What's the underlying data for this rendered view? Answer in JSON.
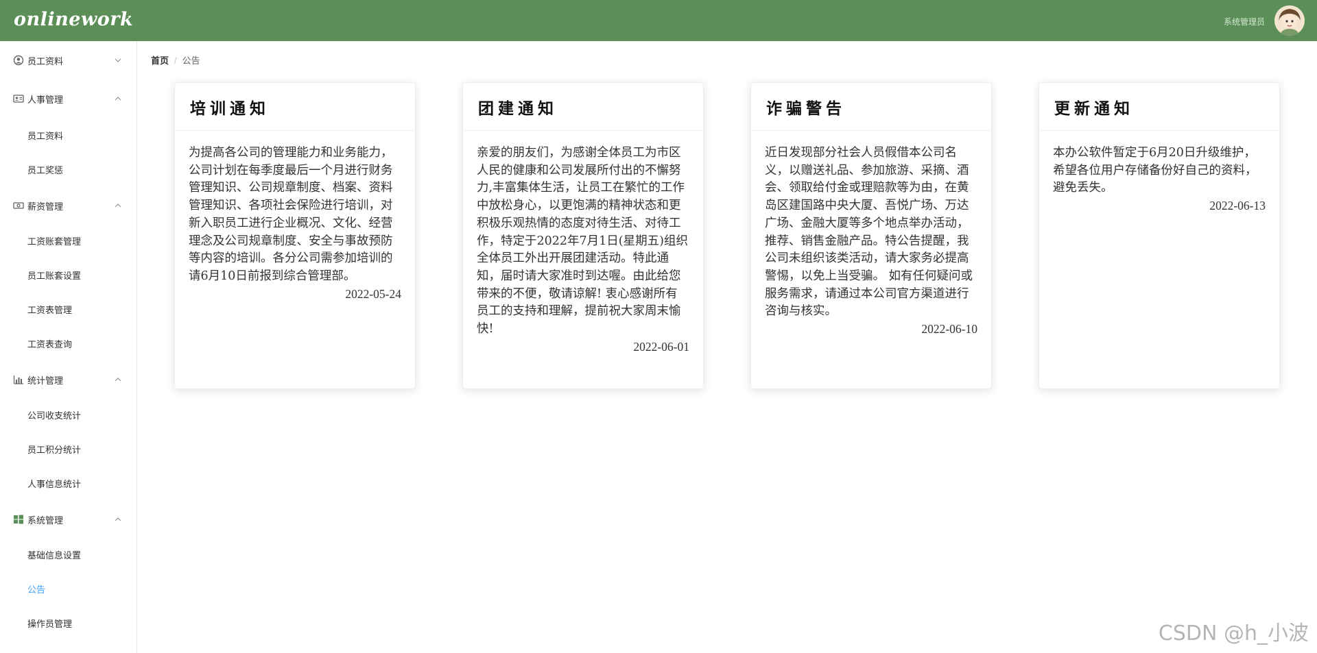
{
  "header": {
    "logo": "onlinework",
    "user": "系统管理员",
    "accent_color": "#5b8f57"
  },
  "sidebar": {
    "groups": [
      {
        "label": "员工资料",
        "icon": "user-circle-icon",
        "expanded": false,
        "items": []
      },
      {
        "label": "人事管理",
        "icon": "id-card-icon",
        "expanded": true,
        "items": [
          "员工资料",
          "员工奖惩"
        ]
      },
      {
        "label": "薪资管理",
        "icon": "money-icon",
        "expanded": true,
        "items": [
          "工资账套管理",
          "员工账套设置",
          "工资表管理",
          "工资表查询"
        ]
      },
      {
        "label": "统计管理",
        "icon": "bar-chart-icon",
        "expanded": true,
        "items": [
          "公司收支统计",
          "员工积分统计",
          "人事信息统计"
        ]
      },
      {
        "label": "系统管理",
        "icon": "windows-icon",
        "expanded": true,
        "items": [
          "基础信息设置",
          "公告",
          "操作员管理"
        ]
      }
    ],
    "active_item": "公告",
    "active_color": "#409eff"
  },
  "breadcrumb": {
    "home": "首页",
    "separator": "/",
    "current": "公告"
  },
  "notices": [
    {
      "title": "培训通知",
      "content": "为提高各公司的管理能力和业务能力，公司计划在每季度最后一个月进行财务管理知识、公司规章制度、档案、资料管理知识、各项社会保险进行培训，对新入职员工进行企业概况、文化、经营理念及公司规章制度、安全与事故预防等内容的培训。各分公司需参加培训的请6月10日前报到综合管理部。",
      "date": "2022-05-24"
    },
    {
      "title": "团建通知",
      "content": "亲爱的朋友们，为感谢全体员工为市区人民的健康和公司发展所付出的不懈努力,丰富集体生活，让员工在繁忙的工作中放松身心，以更饱满的精神状态和更积极乐观热情的态度对待生活、对待工作，特定于2022年7月1日(星期五)组织全体员工外出开展团建活动。特此通知，届时请大家准时到达喔。由此给您带来的不便，敬请谅解! 衷心感谢所有员工的支持和理解，提前祝大家周末愉快!",
      "date": "2022-06-01"
    },
    {
      "title": "诈骗警告",
      "content": "近日发现部分社会人员假借本公司名义，以赠送礼品、参加旅游、采摘、酒会、领取给付金或理赔款等为由，在黄岛区建国路中央大厦、吾悦广场、万达广场、金融大厦等多个地点举办活动，推荐、销售金融产品。特公告提醒，我公司未组织该类活动，请大家务必提高警惕，以免上当受骗。 如有任何疑问或服务需求，请通过本公司官方渠道进行咨询与核实。",
      "date": "2022-06-10"
    },
    {
      "title": "更新通知",
      "content": "本办公软件暂定于6月20日升级维护，希望各位用户存储备份好自己的资料，避免丢失。",
      "date": "2022-06-13"
    }
  ],
  "watermark": "CSDN @h_小波"
}
